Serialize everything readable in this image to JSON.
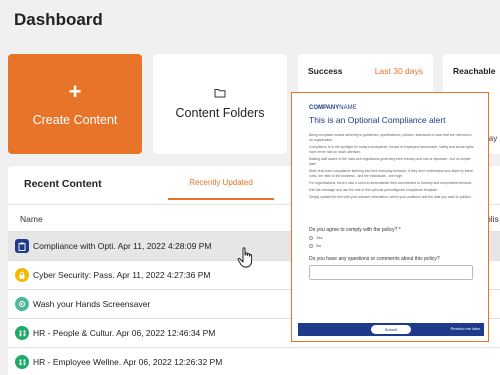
{
  "page": {
    "title": "Dashboard"
  },
  "cards": {
    "create": {
      "plus": "+",
      "label": "Create Content"
    },
    "folders": {
      "label": "Content Folders"
    },
    "success": {
      "label": "Success",
      "range": "Last 30 days"
    },
    "reachable": {
      "label": "Reachable",
      "suffix": "lay"
    }
  },
  "recent": {
    "title": "Recent Content",
    "tab": "Recently Updated",
    "column_name": "Name",
    "column_hint": "blis",
    "rows": [
      {
        "text": "Compliance with Opti. Apr 11, 2022 4:28:09 PM",
        "icon": "clipboard-icon",
        "color": "#1f3a8a"
      },
      {
        "text": "Cyber Security: Pass. Apr 11, 2022 4:27:36 PM",
        "icon": "lock-icon",
        "color": "#f5b800"
      },
      {
        "text": "Wash your Hands Screensaver",
        "icon": "screensaver-icon",
        "color": "#4cb99a"
      },
      {
        "text": "HR - People & Cultur. Apr 06, 2022 12:46:34 PM",
        "icon": "people-icon",
        "color": "#1faa6a"
      },
      {
        "text": "HR - Employee Wellne. Apr 06, 2022 12:26:32 PM",
        "icon": "people-icon",
        "color": "#1faa6a"
      }
    ]
  },
  "preview": {
    "company_bold": "COMPANY",
    "company_rest": "NAME",
    "title": "This is an Optional Compliance alert",
    "paragraphs": [
      "Being compliant means adhering to guidelines, specifications, policies, standards or laws that are relevant to an organisation.",
      "Compliance is in the spotlight for today's workplaces. Issues of employee harassment, safety and social rights have never had so much attention.",
      "Making staff aware of the rules and regulations governing their industry and role is important - but no simple task!",
      "Staff must learn compliance learning into their everyday behavior. If they don't understand and abide by these rules, the risks to the business - and the individuals - are huge.",
      "For organisations, there's also a need to demonstrate their commitment to honesty and responsible behavior.",
      "Edit the message and use the rest of this optional preconfigured compliance template.",
      "Simply update the text with your relevant information, select your audience and the date you want to publish."
    ],
    "question1": "Do you agree to comply with the policy? *",
    "option_yes": "Yes",
    "option_no": "No",
    "question2": "Do you have any questions or comments about this policy?",
    "submit": "Submit",
    "remind": "Remind me later"
  }
}
